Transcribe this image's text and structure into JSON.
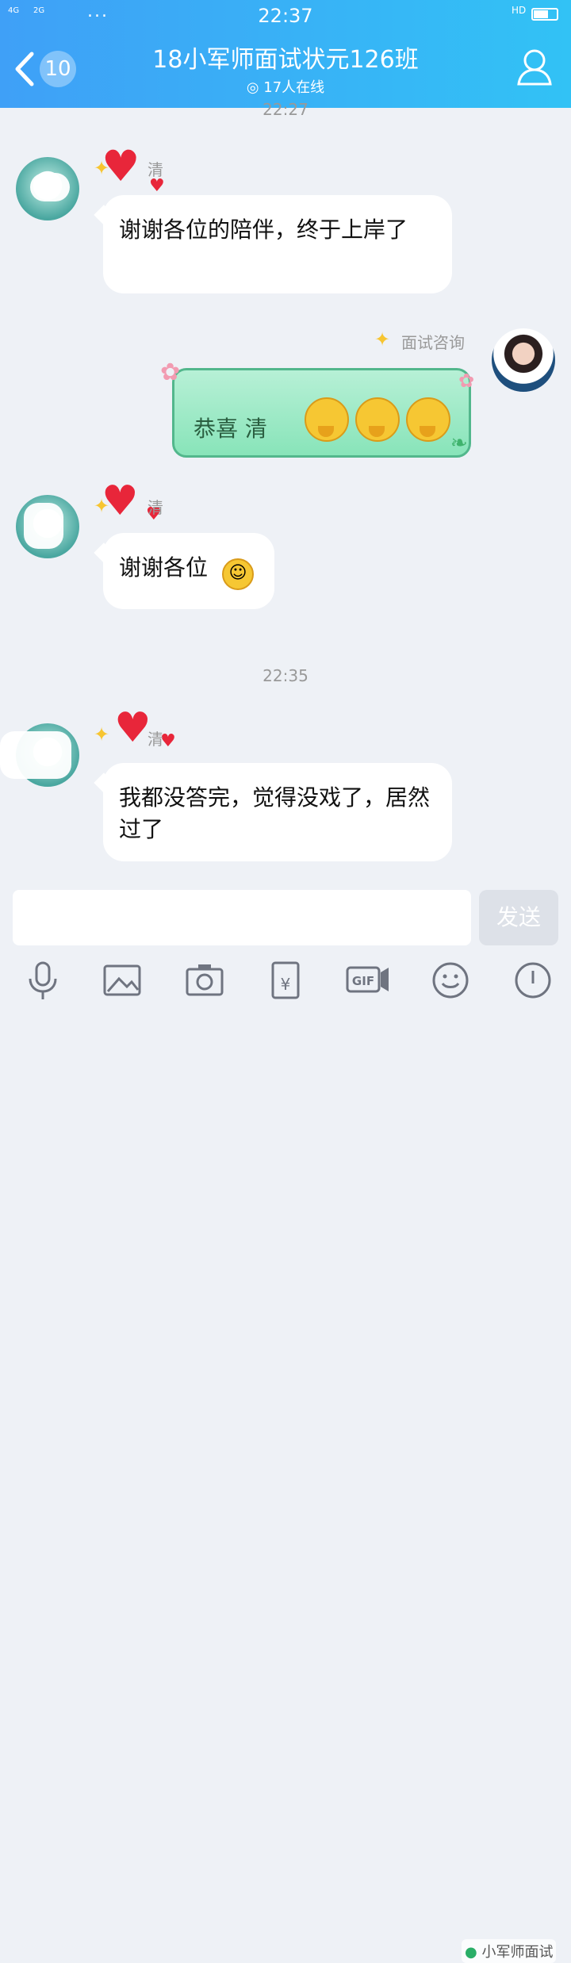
{
  "status_bar": {
    "time": "22:37",
    "signal_left": "4G",
    "signal_right": "2G",
    "battery_icon": "battery-icon",
    "hd_label": "HD",
    "extra_dots": "..."
  },
  "header": {
    "unread_count": "10",
    "title": "18小军师面试状元126班",
    "online_text": "17人在线"
  },
  "messages": [
    {
      "timestamp": "22:27"
    },
    {
      "side": "left",
      "name": "清",
      "text": "谢谢各位的陪伴，终于上岸了"
    },
    {
      "side": "right",
      "name": "面试咨询",
      "text": "恭喜 清"
    },
    {
      "side": "left",
      "name": "清",
      "text": "谢谢各位"
    },
    {
      "timestamp": "22:35"
    },
    {
      "side": "left",
      "name": "清",
      "text": "我都没答完，觉得没戏了，居然过了"
    }
  ],
  "input": {
    "placeholder": "",
    "send_label": "发送"
  },
  "toolbar": {
    "items": [
      "voice",
      "image",
      "camera",
      "red-packet",
      "gif",
      "emoji",
      "more"
    ]
  },
  "watermark": "小军师面试",
  "colors": {
    "header_gradient_start": "#3fa0f7",
    "header_gradient_end": "#32c2f5",
    "green_bubble": "#88e4b9",
    "send_disabled": "#dde1e8"
  }
}
